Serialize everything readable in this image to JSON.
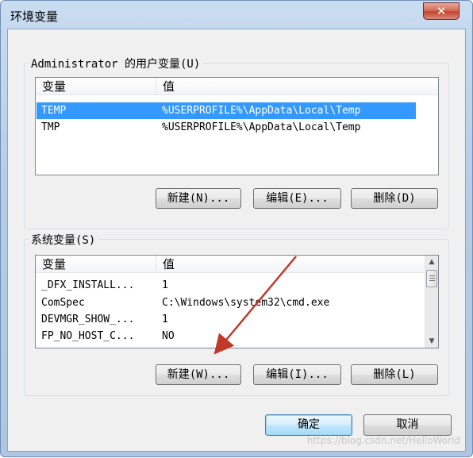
{
  "window": {
    "title": "环境变量",
    "close_label": "✕"
  },
  "user_vars": {
    "group_label": "Administrator 的用户变量(U)",
    "columns": [
      "变量",
      "值"
    ],
    "rows": [
      {
        "name": "TEMP",
        "value": "%USERPROFILE%\\AppData\\Local\\Temp",
        "selected": true
      },
      {
        "name": "TMP",
        "value": "%USERPROFILE%\\AppData\\Local\\Temp",
        "selected": false
      }
    ],
    "buttons": {
      "new": "新建(N)...",
      "edit": "编辑(E)...",
      "delete": "删除(D)"
    }
  },
  "system_vars": {
    "group_label": "系统变量(S)",
    "columns": [
      "变量",
      "值"
    ],
    "rows": [
      {
        "name": "_DFX_INSTALL...",
        "value": "1"
      },
      {
        "name": "ComSpec",
        "value": "C:\\Windows\\system32\\cmd.exe"
      },
      {
        "name": "DEVMGR_SHOW_...",
        "value": "1"
      },
      {
        "name": "FP_NO_HOST_C...",
        "value": "NO"
      }
    ],
    "buttons": {
      "new": "新建(W)...",
      "edit": "编辑(I)...",
      "delete": "删除(L)"
    }
  },
  "dialog_buttons": {
    "ok": "确定",
    "cancel": "取消"
  },
  "watermark": "https://blog.csdn.net/HelloWorld",
  "icons": {
    "scroll_up": "▲",
    "scroll_down": "▼",
    "annotation": "red-arrow-icon"
  },
  "colors": {
    "selection": "#3399ff",
    "arrow": "#c0392b"
  }
}
